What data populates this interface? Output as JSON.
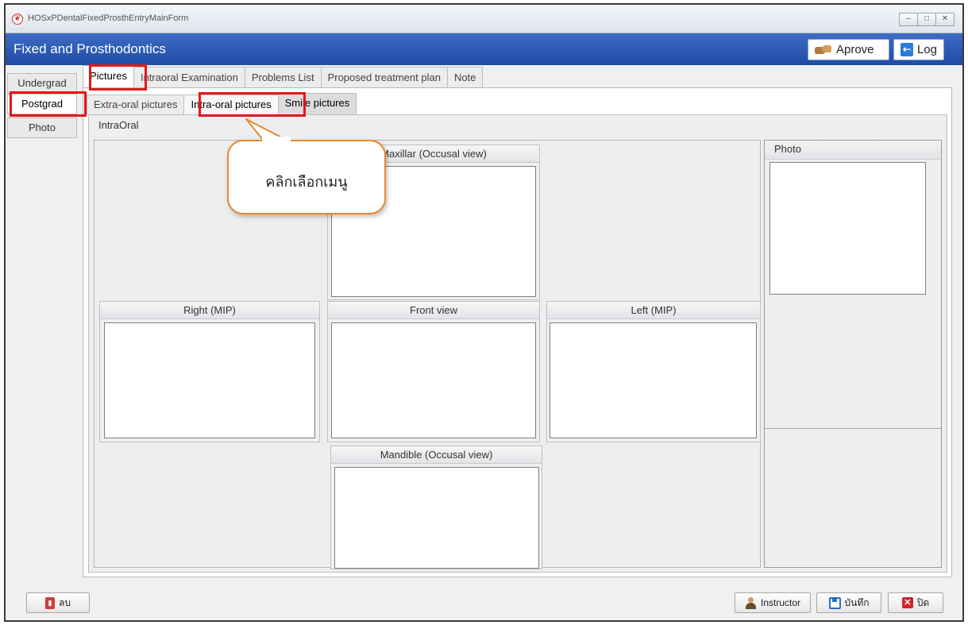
{
  "window": {
    "title": "HOSxPDentalFixedProsthEntryMainForm",
    "controls": {
      "minimize": "–",
      "maximize": "□",
      "close": "✕"
    }
  },
  "header": {
    "title": "Fixed and Prosthodontics",
    "approve_label": "Aprove",
    "log_label": "Log"
  },
  "side_tabs": [
    "Undergrad",
    "Postgrad",
    "Photo"
  ],
  "main_tabs": [
    "Pictures",
    "Intraoral Examination",
    "Problems List",
    "Proposed treatment plan",
    "Note"
  ],
  "sub_tabs": [
    "Extra-oral pictures",
    "Intra-oral pictures",
    "Smile pictures"
  ],
  "intraoral": {
    "title": "IntraOral",
    "maxillar": "Maxillar (Occusal view)",
    "right": "Right (MIP)",
    "front": "Front view",
    "left": "Left (MIP)",
    "mandible": "Mandible (Occusal view)",
    "photo": "Photo"
  },
  "callout_text": "คลิกเลือกเมนู",
  "footer": {
    "delete_label": "ลบ",
    "instructor_label": "Instructor",
    "save_label": "บันทึก",
    "close_label": "ปิด"
  },
  "colors": {
    "header_blue": "#2a58b5",
    "highlight_red": "#e8141c",
    "callout_orange": "#e6892e"
  }
}
